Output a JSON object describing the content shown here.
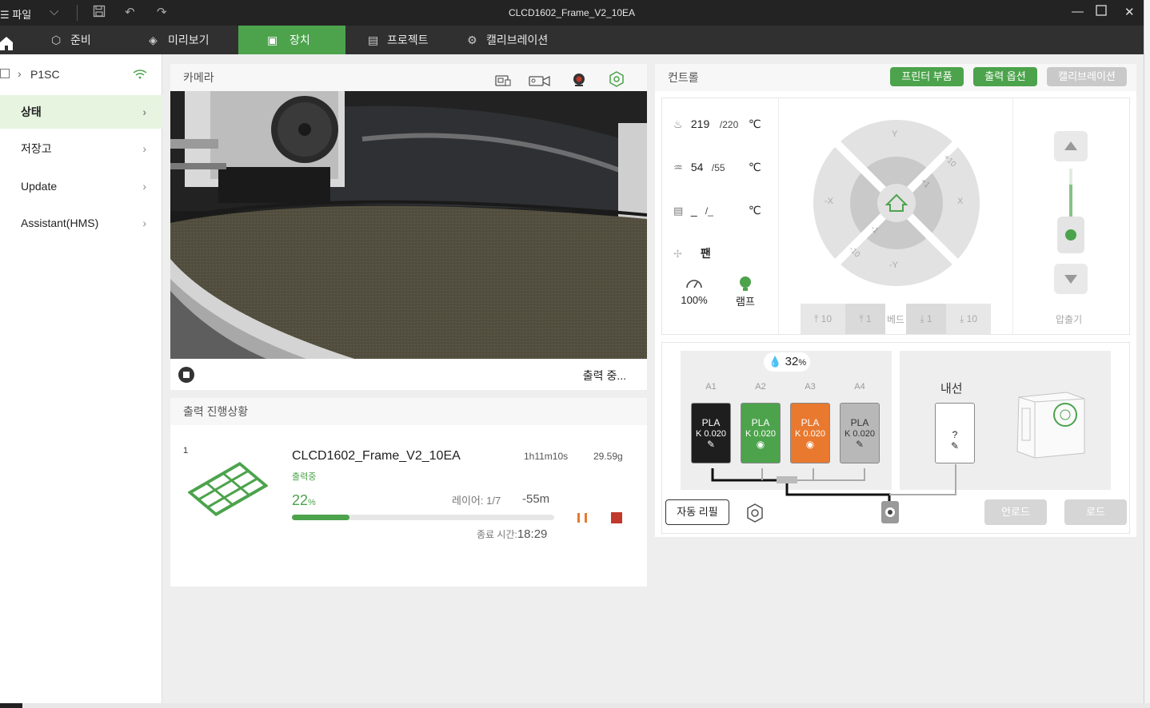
{
  "window": {
    "title": "CLCD1602_Frame_V2_10EA",
    "file_menu": "파일"
  },
  "tabs": [
    {
      "label": "준비",
      "icon": "cube-icon"
    },
    {
      "label": "미리보기",
      "icon": "layers-icon"
    },
    {
      "label": "장치",
      "icon": "device-icon",
      "active": true
    },
    {
      "label": "프로젝트",
      "icon": "list-icon"
    },
    {
      "label": "캘리브레이션",
      "icon": "calibration-icon"
    }
  ],
  "sidebar": {
    "printer": "P1SC",
    "items": [
      {
        "label": "상태",
        "active": true
      },
      {
        "label": "저장고"
      },
      {
        "label": "Update"
      },
      {
        "label": "Assistant(HMS)"
      }
    ]
  },
  "camera": {
    "title": "카메라",
    "status": "출력 중..."
  },
  "progress": {
    "title": "출력 진행상황",
    "plate": "1",
    "job_name": "CLCD1602_Frame_V2_10EA",
    "time": "1h11m10s",
    "weight": "29.59g",
    "state": "출력중",
    "percent_num": "22",
    "percent_sign": "%",
    "percent_value": 22,
    "layer_label": "레이어: 1/7",
    "remaining": "-55m",
    "end_label": "종료 시간:",
    "end_time": "18:29"
  },
  "control": {
    "title": "컨트롤",
    "buttons": {
      "parts": "프린터 부품",
      "options": "출력 옵션",
      "calibration": "캘리브레이션"
    },
    "nozzle": {
      "current": "219",
      "target": "/220",
      "unit": "℃"
    },
    "bed": {
      "current": "54",
      "target": "/55",
      "unit": "℃"
    },
    "chamber": {
      "current": "_",
      "target": "/_",
      "unit": "℃"
    },
    "fan_label": "팬",
    "speed_label": "100%",
    "lamp_label": "램프",
    "jog": {
      "y": "Y",
      "neg_y": "-Y",
      "x": "X",
      "neg_x": "-X",
      "plus10": "+10",
      "plus1": "+1",
      "minus1": "-1",
      "minus10": "-10"
    },
    "bed_buttons": {
      "up10": "10",
      "up1": "1",
      "label": "베드",
      "down1": "1",
      "down10": "10"
    },
    "extruder_label": "압출기"
  },
  "ams": {
    "humidity_num": "32",
    "humidity_unit": "%",
    "slots": [
      {
        "id": "A1",
        "type": "PLA",
        "k": "K 0.020",
        "color": "#1e1e1e"
      },
      {
        "id": "A2",
        "type": "PLA",
        "k": "K 0.020",
        "color": "#4ca34c"
      },
      {
        "id": "A3",
        "type": "PLA",
        "k": "K 0.020",
        "color": "#e8792f"
      },
      {
        "id": "A4",
        "type": "PLA",
        "k": "K 0.020",
        "color": "#b8b8b8"
      }
    ],
    "external_label": "내선",
    "external_slot": "?",
    "auto_refill": "자동 리필",
    "unload": "언로드",
    "load": "로드"
  },
  "colors": {
    "accent": "#4ca34c",
    "titlebar": "#232323",
    "tabbar": "#303030",
    "stop_red": "#c0392b",
    "pause_orange": "#e8792f"
  }
}
